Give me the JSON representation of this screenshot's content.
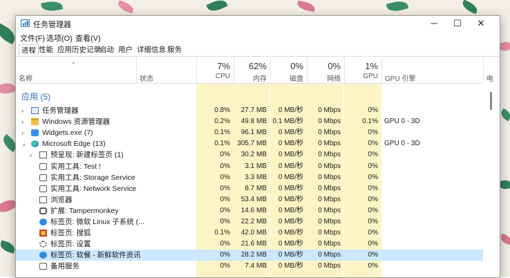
{
  "window": {
    "title": "任务管理器",
    "minimize_glyph": "─",
    "maximize_glyph": "☐",
    "close_glyph": "✕"
  },
  "menu": [
    "文件(F)",
    "选项(O)",
    "查看(V)"
  ],
  "tabs": [
    "进程",
    "性能",
    "应用历史记录",
    "启动",
    "用户",
    "详细信息",
    "服务"
  ],
  "header": {
    "name": "名称",
    "status": "状态",
    "cpu_pct": "7%",
    "cpu": "CPU",
    "mem_pct": "62%",
    "mem": "内存",
    "disk_pct": "0%",
    "disk": "磁盘",
    "net_pct": "0%",
    "net": "网络",
    "gpu_pct": "1%",
    "gpu": "GPU",
    "gpu_engine": "GPU 引擎",
    "power": "电"
  },
  "group_label": "应用 (5)",
  "rows": [
    {
      "indent": 0,
      "expander": "›",
      "icon": "taskmgr-icon",
      "name": "任务管理器",
      "cpu": "0.8%",
      "mem": "27.7 MB",
      "disk": "0 MB/秒",
      "net": "0 Mbps",
      "gpu": "0%",
      "engine": ""
    },
    {
      "indent": 0,
      "expander": "›",
      "icon": "folder-icon",
      "name": "Windows 资源管理器",
      "cpu": "0.2%",
      "mem": "49.8 MB",
      "disk": "0.1 MB/秒",
      "net": "0 Mbps",
      "gpu": "0.1%",
      "engine": "GPU 0 - 3D"
    },
    {
      "indent": 0,
      "expander": "›",
      "icon": "widgets-icon",
      "name": "Widgets.exe (7)",
      "cpu": "0.1%",
      "mem": "96.1 MB",
      "disk": "0 MB/秒",
      "net": "0 Mbps",
      "gpu": "0%",
      "engine": ""
    },
    {
      "indent": 0,
      "expander": "⌄",
      "icon": "edge-icon",
      "name": "Microsoft Edge (13)",
      "cpu": "0.1%",
      "mem": "305.7 MB",
      "disk": "0 MB/秒",
      "net": "0 Mbps",
      "gpu": "0%",
      "engine": "GPU 0 - 3D"
    },
    {
      "indent": 1,
      "expander": "›",
      "icon": "page-icon",
      "name": "预呈现: 新建标签页 (1)",
      "cpu": "0%",
      "mem": "30.2 MB",
      "disk": "0 MB/秒",
      "net": "0 Mbps",
      "gpu": "0%",
      "engine": ""
    },
    {
      "indent": 2,
      "expander": "",
      "icon": "tool-icon",
      "name": "实用工具: Test !",
      "cpu": "0%",
      "mem": "3.1 MB",
      "disk": "0 MB/秒",
      "net": "0 Mbps",
      "gpu": "0%",
      "engine": ""
    },
    {
      "indent": 2,
      "expander": "",
      "icon": "tool-icon",
      "name": "实用工具: Storage Service",
      "cpu": "0%",
      "mem": "3.3 MB",
      "disk": "0 MB/秒",
      "net": "0 Mbps",
      "gpu": "0%",
      "engine": ""
    },
    {
      "indent": 2,
      "expander": "",
      "icon": "tool-icon",
      "name": "实用工具: Network Service",
      "cpu": "0%",
      "mem": "8.7 MB",
      "disk": "0 MB/秒",
      "net": "0 Mbps",
      "gpu": "0%",
      "engine": ""
    },
    {
      "indent": 2,
      "expander": "",
      "icon": "browser-icon",
      "name": "浏览器",
      "cpu": "0%",
      "mem": "53.4 MB",
      "disk": "0 MB/秒",
      "net": "0 Mbps",
      "gpu": "0%",
      "engine": ""
    },
    {
      "indent": 2,
      "expander": "",
      "icon": "puzzle-icon",
      "name": "扩展: Tampermonkey",
      "cpu": "0%",
      "mem": "14.6 MB",
      "disk": "0 MB/秒",
      "net": "0 Mbps",
      "gpu": "0%",
      "engine": ""
    },
    {
      "indent": 2,
      "expander": "",
      "icon": "tab-blue-icon",
      "name": "标签页: 微软 Linux 子系统 (...",
      "cpu": "0%",
      "mem": "22.2 MB",
      "disk": "0 MB/秒",
      "net": "0 Mbps",
      "gpu": "0%",
      "engine": ""
    },
    {
      "indent": 2,
      "expander": "",
      "icon": "tab-red-icon",
      "name": "标签页: 搜狐",
      "cpu": "0.1%",
      "mem": "42.0 MB",
      "disk": "0 MB/秒",
      "net": "0 Mbps",
      "gpu": "0%",
      "engine": ""
    },
    {
      "indent": 2,
      "expander": "",
      "icon": "gear-icon",
      "name": "标签页: 设置",
      "cpu": "0%",
      "mem": "21.6 MB",
      "disk": "0 MB/秒",
      "net": "0 Mbps",
      "gpu": "0%",
      "engine": ""
    },
    {
      "indent": 2,
      "expander": "",
      "icon": "tab-blue-icon",
      "name": "标签页: 软餐 - 新鲜软件资讯",
      "cpu": "0%",
      "mem": "28.2 MB",
      "disk": "0 MB/秒",
      "net": "0 Mbps",
      "gpu": "0%",
      "engine": "",
      "selected": true
    },
    {
      "indent": 2,
      "expander": "",
      "icon": "tool-icon",
      "name": "备用服务",
      "cpu": "0%",
      "mem": "7.4 MB",
      "disk": "0 MB/秒",
      "net": "0 Mbps",
      "gpu": "0%",
      "engine": ""
    }
  ],
  "colors": {
    "heat": "#fdf4c5",
    "selected": "#cce8ff",
    "accent": "#2a6ebb"
  }
}
